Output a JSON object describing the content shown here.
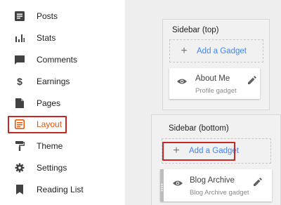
{
  "nav": {
    "posts": "Posts",
    "stats": "Stats",
    "comments": "Comments",
    "earnings": "Earnings",
    "pages": "Pages",
    "layout": "Layout",
    "theme": "Theme",
    "settings": "Settings",
    "reading_list": "Reading List"
  },
  "sidebar_top": {
    "title": "Sidebar (top)",
    "add_label": "Add a Gadget",
    "gadget": {
      "title": "About Me",
      "subtitle": "Profile gadget"
    }
  },
  "sidebar_bottom": {
    "title": "Sidebar (bottom)",
    "add_label": "Add a Gadget",
    "gadget": {
      "title": "Blog Archive",
      "subtitle": "Blog Archive gadget"
    }
  },
  "colors": {
    "accent": "#e65100",
    "link": "#4285f4",
    "highlight": "#c62828"
  }
}
